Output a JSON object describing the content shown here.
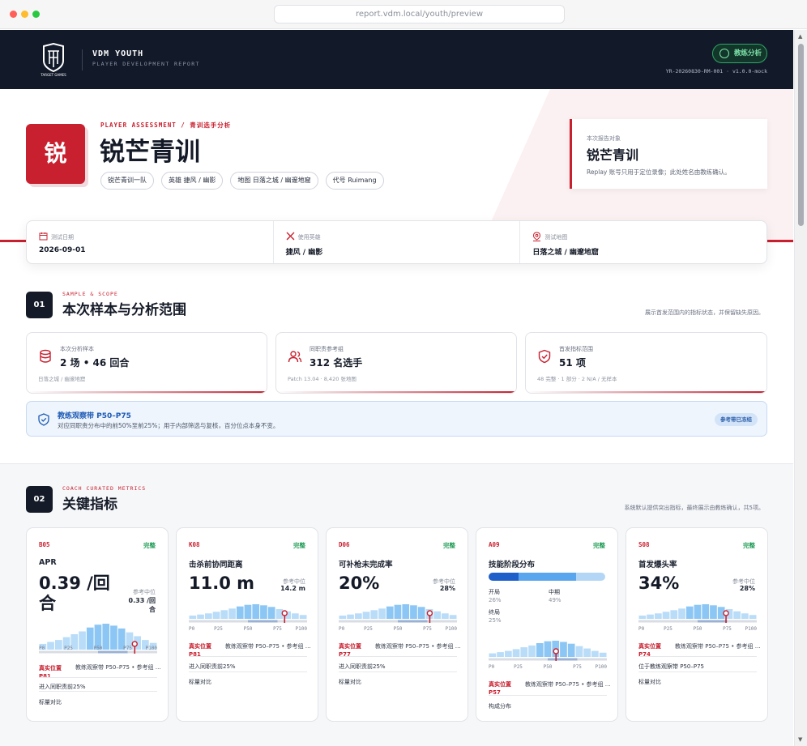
{
  "browser": {
    "url": "report.vdm.local/youth/preview"
  },
  "header": {
    "brand": "VDM YOUTH",
    "subtitle": "PLAYER DEVELOPMENT REPORT",
    "badge": "教练分析",
    "report_id": "YR-20260830-RM-001 · v1.0.0-mock",
    "logo_caption": "TARGET GAMES"
  },
  "hero": {
    "avatar_char": "锐",
    "kicker": "PLAYER ASSESSMENT / 青训选手分析",
    "player_name": "锐芒青训",
    "tags": [
      "锐芒青训一队",
      "英雄 捷风 / 幽影",
      "地图 日落之城 / 幽邃地窟",
      "代号 Ruimang"
    ],
    "target": {
      "label": "本次报告对象",
      "name": "锐芒青训",
      "desc": "Replay 账号只用于定位录像；此处姓名由教练确认。"
    }
  },
  "info": [
    {
      "icon": "calendar-icon",
      "label": "测试日期",
      "value": "2026-09-01"
    },
    {
      "icon": "swords-icon",
      "label": "使用英雄",
      "value": "捷风 / 幽影"
    },
    {
      "icon": "map-pin-icon",
      "label": "测试地图",
      "value": "日落之城 / 幽邃地窟"
    }
  ],
  "section1": {
    "num": "01",
    "kicker": "SAMPLE & SCOPE",
    "title": "本次样本与分析范围",
    "note": "展示首发范围内的指标状态，并保留缺失原因。",
    "cards": [
      {
        "label": "本次分析样本",
        "value": "2 场 • 46 回合",
        "sub": "日落之城 / 幽邃地窟"
      },
      {
        "label": "同职责参考组",
        "value": "312 名选手",
        "sub": "Patch 13.04 · 8,420 张地图"
      },
      {
        "label": "首发指标范围",
        "value": "51 项",
        "sub": "48 完整 · 1 部分 · 2 N/A / 无样本"
      }
    ],
    "band": {
      "title": "教练观察带 P50–P75",
      "desc": "对应同职责分布中的前50%至前25%；用于内部筛选与复核，百分位点本身不变。",
      "pill": "参考带已冻结"
    }
  },
  "section2": {
    "num": "02",
    "kicker": "COACH CURATED METRICS",
    "title": "关键指标",
    "note": "系统默认提供突出指标，最终展示由教练确认，共5项。"
  },
  "axis": [
    "P0",
    "P25",
    "P50",
    "P75",
    "P100"
  ],
  "metrics": [
    {
      "code": "B05",
      "status": "完整",
      "name": "APR",
      "value": "0.39 /回合",
      "ref_label": "参考中位",
      "ref_value": "0.33 /回合",
      "percentile": 81,
      "pos_label": "真实位置",
      "pos_value": "P81",
      "band": "教练观察带 P50–P75 • 参考组 …",
      "line2": "进入同职责前25%",
      "line3": "标量对比"
    },
    {
      "code": "K08",
      "status": "完整",
      "name": "击杀前协同距离",
      "value": "11.0 m",
      "ref_label": "参考中位",
      "ref_value": "14.2 m",
      "percentile": 81,
      "pos_label": "真实位置",
      "pos_value": "P81",
      "band": "教练观察带 P50–P75 • 参考组 …",
      "line2": "进入同职责前25%",
      "line3": "标量对比"
    },
    {
      "code": "D06",
      "status": "完整",
      "name": "可补枪未完成率",
      "value": "20%",
      "ref_label": "参考中位",
      "ref_value": "28%",
      "percentile": 77,
      "pos_label": "真实位置",
      "pos_value": "P77",
      "band": "教练观察带 P50–P75 • 参考组 …",
      "line2": "进入同职责前25%",
      "line3": "标量对比"
    },
    {
      "code": "A09",
      "status": "完整",
      "name": "技能阶段分布",
      "stages": [
        {
          "label": "开局",
          "pct": "26%",
          "share": 26
        },
        {
          "label": "中期",
          "pct": "49%",
          "share": 49
        },
        {
          "label": "终局",
          "pct": "25%",
          "share": 25
        }
      ],
      "percentile": 57,
      "pos_label": "真实位置",
      "pos_value": "P57",
      "band": "教练观察带 P50–P75 • 参考组 …",
      "line3": "构成分布"
    },
    {
      "code": "S08",
      "status": "完整",
      "name": "首发爆头率",
      "value": "34%",
      "ref_label": "参考中位",
      "ref_value": "28%",
      "percentile": 74,
      "pos_label": "真实位置",
      "pos_value": "P74",
      "band": "教练观察带 P50–P75 • 参考组 …",
      "line2": "位于教练观察带 P50–P75",
      "line3": "标量对比"
    }
  ],
  "colors": {
    "accent": "#c8202f",
    "navy": "#121a2a",
    "green": "#1f9b55",
    "blue": "#1f5bb5"
  }
}
